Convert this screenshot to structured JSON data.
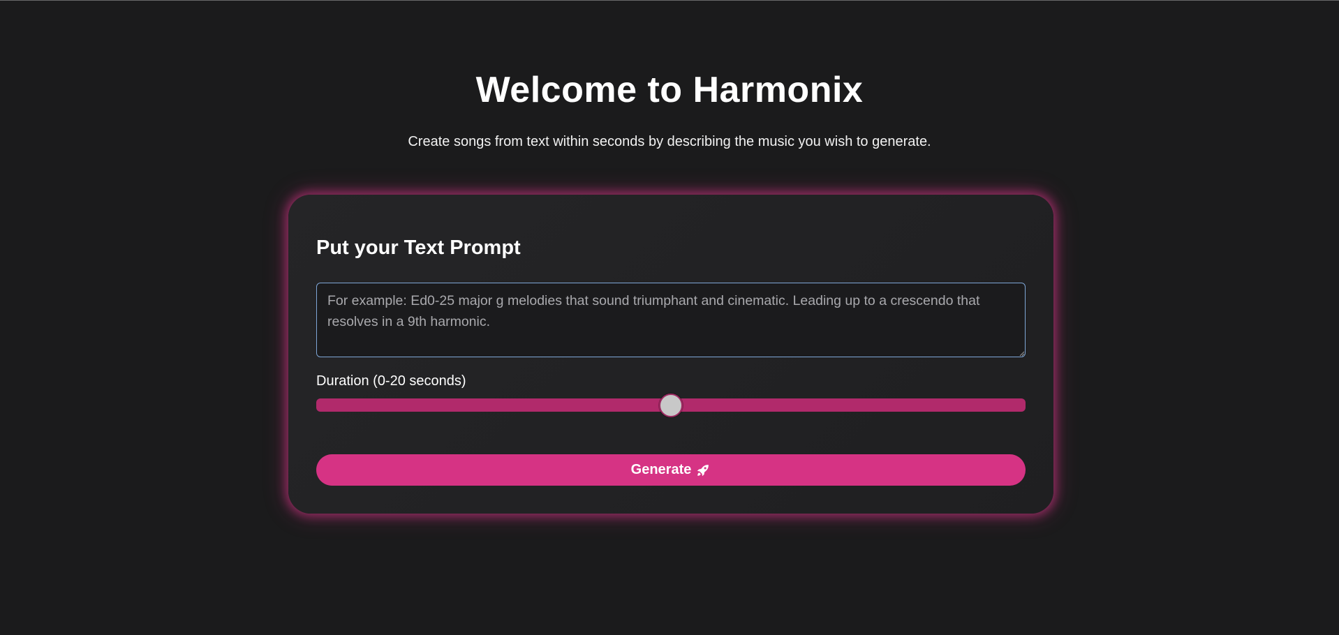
{
  "header": {
    "title": "Welcome to Harmonix",
    "subtitle": "Create songs from text within seconds by describing the music you wish to generate."
  },
  "form": {
    "title": "Put your Text Prompt",
    "prompt": {
      "value": "",
      "placeholder": "For example: Ed0-25 major g melodies that sound triumphant and cinematic. Leading up to a crescendo that resolves in a 9th harmonic."
    },
    "duration": {
      "label": "Duration (0-20 seconds)",
      "min": 0,
      "max": 20,
      "value": 10
    },
    "generate_button": {
      "label": "Generate",
      "icon": "rocket-icon"
    }
  },
  "colors": {
    "background": "#1b1b1c",
    "accent": "#d63384",
    "slider_track": "#b12a6b",
    "card_glow": "#d63487"
  }
}
